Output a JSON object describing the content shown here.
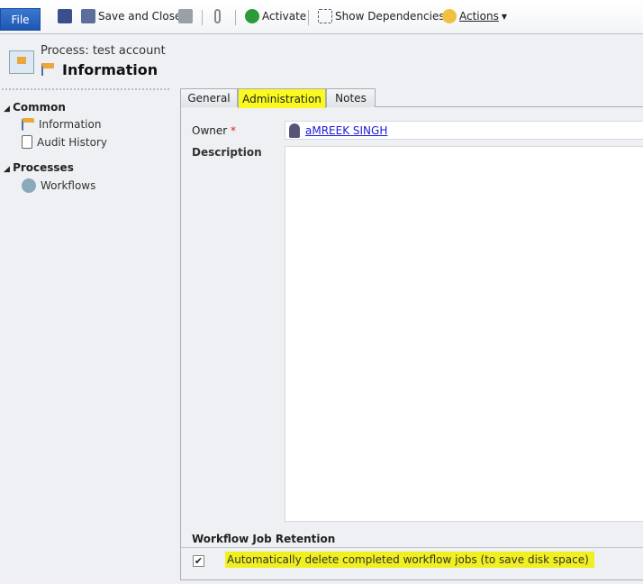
{
  "toolbar": {
    "file": "File",
    "save_and_close": "Save and Close",
    "activate": "Activate",
    "show_dependencies": "Show Dependencies",
    "actions": "Actions"
  },
  "header": {
    "entity": "Process: test account",
    "title": "Information"
  },
  "nav": {
    "common": "Common",
    "information": "Information",
    "audit_history": "Audit History",
    "processes": "Processes",
    "workflows": "Workflows"
  },
  "tabs": {
    "general": "General",
    "administration": "Administration",
    "notes": "Notes",
    "active": "Administration"
  },
  "form": {
    "owner_label": "Owner",
    "required_mark": "*",
    "owner_value": "aMREEK SINGH",
    "description_label": "Description",
    "description_value": "",
    "section_title": "Workflow Job Retention",
    "checkbox_label": "Automatically delete completed workflow jobs (to save disk space)",
    "checkbox_checked": true,
    "checkmark": "✔"
  },
  "colors": {
    "highlight": "#f0f020",
    "file_button": "#2a64c0",
    "link": "#1a1ad6"
  }
}
